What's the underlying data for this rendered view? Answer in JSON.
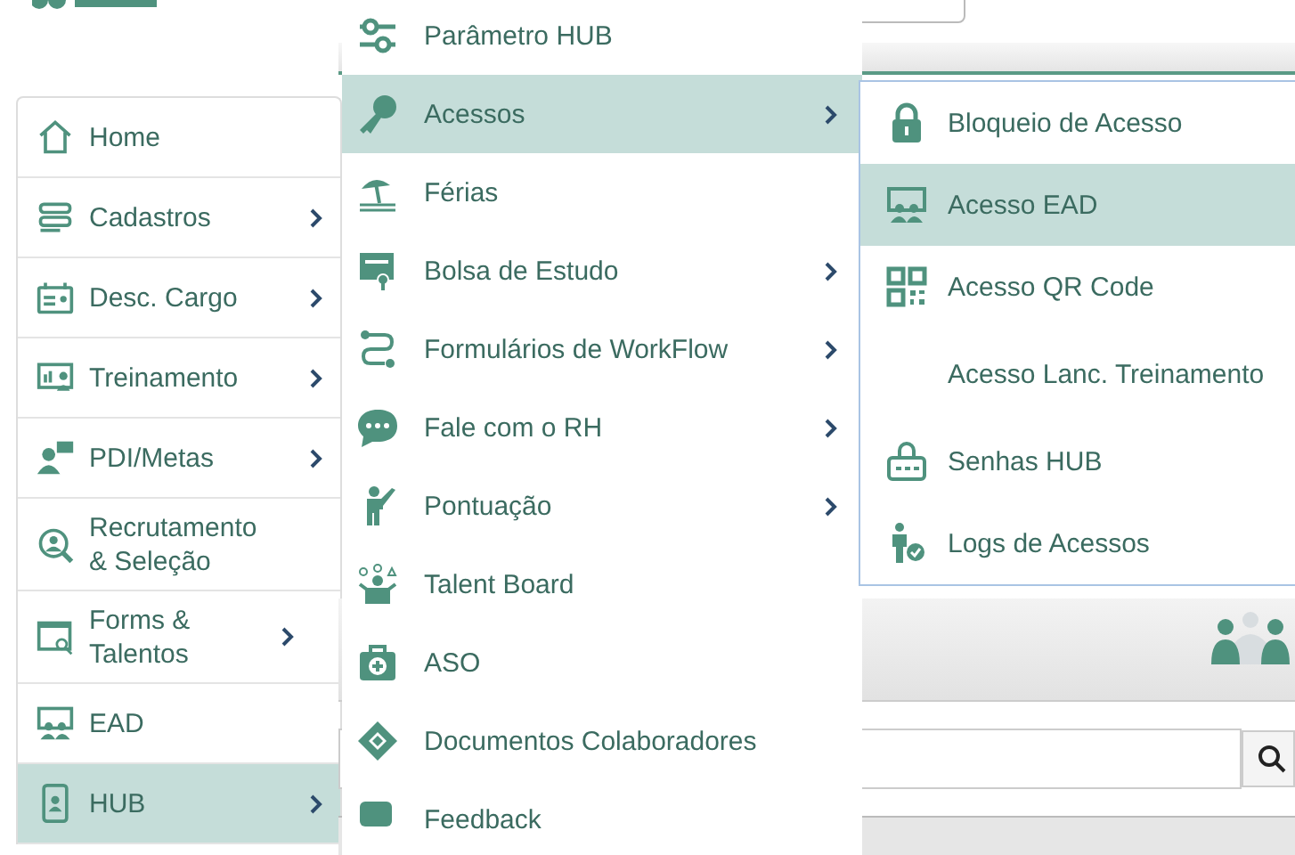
{
  "sidebar": {
    "items": [
      {
        "label": "Home",
        "has_submenu": false,
        "selected": false
      },
      {
        "label": "Cadastros",
        "has_submenu": true,
        "selected": false
      },
      {
        "label": "Desc. Cargo",
        "has_submenu": true,
        "selected": false
      },
      {
        "label": "Treinamento",
        "has_submenu": true,
        "selected": false
      },
      {
        "label": "PDI/Metas",
        "has_submenu": true,
        "selected": false
      },
      {
        "label": "Recrutamento & Seleção",
        "has_submenu": false,
        "selected": false
      },
      {
        "label": "Forms & Talentos",
        "has_submenu": true,
        "selected": false
      },
      {
        "label": "EAD",
        "has_submenu": false,
        "selected": false
      },
      {
        "label": "HUB",
        "has_submenu": true,
        "selected": true
      }
    ]
  },
  "submenu": {
    "items": [
      {
        "label": "Parâmetro HUB",
        "has_submenu": false,
        "selected": false
      },
      {
        "label": "Acessos",
        "has_submenu": true,
        "selected": true
      },
      {
        "label": "Férias",
        "has_submenu": false,
        "selected": false
      },
      {
        "label": "Bolsa de Estudo",
        "has_submenu": true,
        "selected": false
      },
      {
        "label": "Formulários de WorkFlow",
        "has_submenu": true,
        "selected": false
      },
      {
        "label": "Fale com o RH",
        "has_submenu": true,
        "selected": false
      },
      {
        "label": "Pontuação",
        "has_submenu": true,
        "selected": false
      },
      {
        "label": "Talent Board",
        "has_submenu": false,
        "selected": false
      },
      {
        "label": "ASO",
        "has_submenu": false,
        "selected": false
      },
      {
        "label": "Documentos Colaboradores",
        "has_submenu": false,
        "selected": false
      },
      {
        "label": "Feedback",
        "has_submenu": false,
        "selected": false
      }
    ]
  },
  "access_menu": {
    "items": [
      {
        "label": "Bloqueio de Acesso",
        "selected": false
      },
      {
        "label": "Acesso EAD",
        "selected": true
      },
      {
        "label": "Acesso QR Code",
        "selected": false
      },
      {
        "label": "Acesso Lanc. Treinamento",
        "selected": false
      },
      {
        "label": "Senhas HUB",
        "selected": false
      },
      {
        "label": "Logs de Acessos",
        "selected": false
      }
    ]
  }
}
